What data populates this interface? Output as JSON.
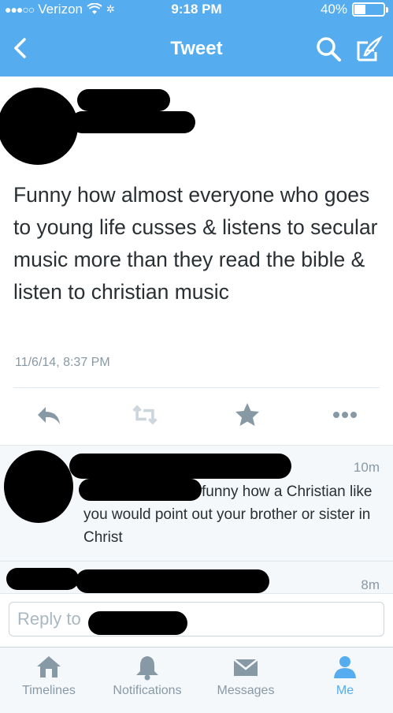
{
  "status_bar": {
    "carrier": "Verizon",
    "time": "9:18 PM",
    "battery": "40%",
    "battery_level": 0.4
  },
  "nav": {
    "title": "Tweet",
    "icons": [
      "back-icon",
      "search-icon",
      "compose-icon"
    ]
  },
  "tweet": {
    "text": "Funny how almost everyone who goes to young life cusses & listens to secular music more than they read the bible & listen to christian music",
    "timestamp": "11/6/14, 8:37 PM",
    "actions": [
      "reply-icon",
      "retweet-icon",
      "favorite-icon",
      "more-icon"
    ]
  },
  "replies": [
    {
      "time": "10m",
      "text": "funny how a Christian like you would point out your brother or sister in Christ"
    },
    {
      "time": "8m"
    }
  ],
  "composer": {
    "placeholder": "Reply to"
  },
  "tabbar": {
    "tabs": [
      {
        "label": "Timelines",
        "icon": "home-icon"
      },
      {
        "label": "Notifications",
        "icon": "bell-icon"
      },
      {
        "label": "Messages",
        "icon": "envelope-icon"
      },
      {
        "label": "Me",
        "icon": "person-icon"
      }
    ],
    "active_tab": "Me"
  },
  "colors": {
    "brand": "#55acee",
    "text": "#292f33",
    "muted": "#8899a6"
  }
}
